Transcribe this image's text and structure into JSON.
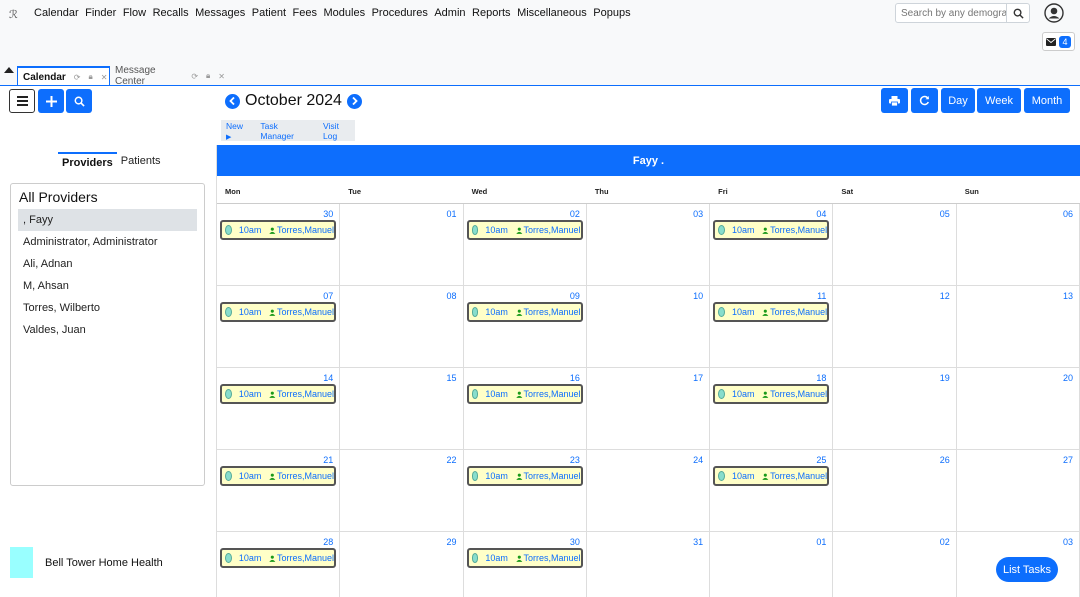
{
  "nav": {
    "menu": [
      "Calendar",
      "Finder",
      "Flow",
      "Recalls",
      "Messages",
      "Patient",
      "Fees",
      "Modules",
      "Procedures",
      "Admin",
      "Reports",
      "Miscellaneous",
      "Popups"
    ],
    "search_placeholder": "Search by any demograp",
    "mail_count": "4"
  },
  "tabs": [
    {
      "label": "Calendar",
      "active": true
    },
    {
      "label": "Message Center",
      "active": false
    }
  ],
  "toolbar": {
    "month_title": "October 2024",
    "views": [
      "Day",
      "Week",
      "Month"
    ],
    "sub": {
      "new": "New",
      "task_manager": "Task Manager",
      "visit_log": "Visit Log"
    }
  },
  "left": {
    "tabs": [
      "Providers",
      "Patients"
    ],
    "box_title": "All Providers",
    "providers": [
      ", Fayy",
      "Administrator, Administrator",
      "Ali, Adnan",
      "M, Ahsan",
      "Torres, Wilberto",
      "Valdes, Juan"
    ],
    "selected_index": 0,
    "legend": {
      "label": "Bell Tower Home Health",
      "color": "#99ffff"
    }
  },
  "calendar": {
    "header": "Fayy .",
    "days_of_week": [
      "Mon",
      "Tue",
      "Wed",
      "Thu",
      "Fri",
      "Sat",
      "Sun"
    ],
    "weeks": [
      [
        "30",
        "01",
        "02",
        "03",
        "04",
        "05",
        "06"
      ],
      [
        "07",
        "08",
        "09",
        "10",
        "11",
        "12",
        "13"
      ],
      [
        "14",
        "15",
        "16",
        "17",
        "18",
        "19",
        "20"
      ],
      [
        "21",
        "22",
        "23",
        "24",
        "25",
        "26",
        "27"
      ],
      [
        "28",
        "29",
        "30",
        "31",
        "01",
        "02",
        "03"
      ]
    ],
    "event": {
      "time": "10am",
      "patient": "Torres,Manuel"
    },
    "event_columns": [
      0,
      2,
      4
    ],
    "event_rows_last_week": [
      0,
      2
    ]
  },
  "list_tasks_label": "List Tasks",
  "colors": {
    "accent": "#0d6efd",
    "event_bg": "#ffffc8"
  }
}
